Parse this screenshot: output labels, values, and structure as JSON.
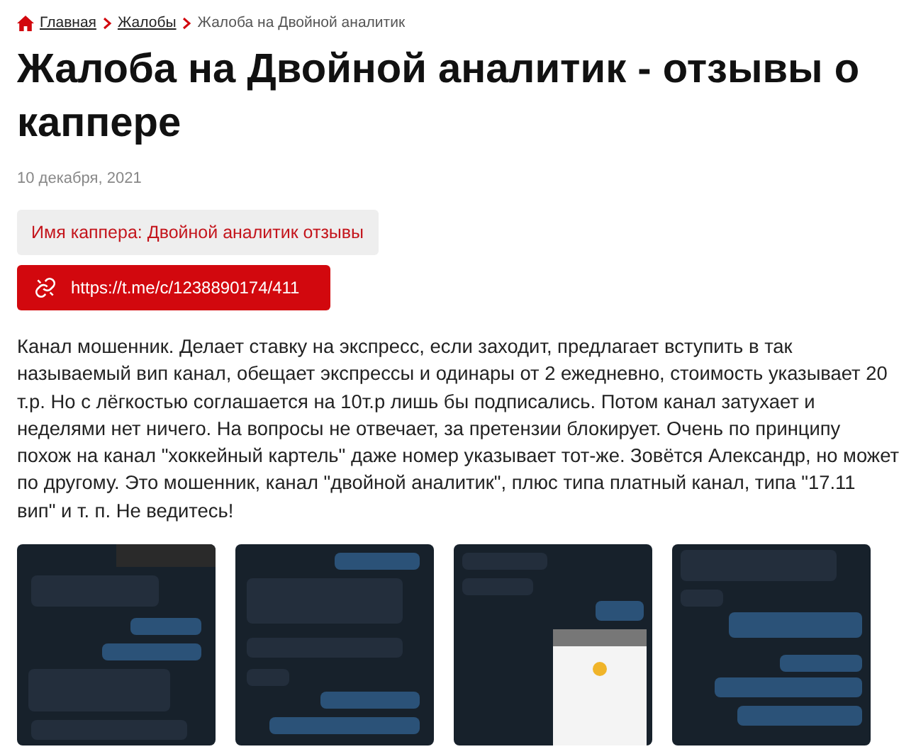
{
  "breadcrumbs": [
    {
      "label": "Главная",
      "link": true
    },
    {
      "label": "Жалобы",
      "link": true
    },
    {
      "label": "Жалоба на Двойной аналитик",
      "link": false
    }
  ],
  "title": "Жалоба на Двойной аналитик - отзывы о каппере",
  "date": "10 декабря, 2021",
  "capper_name": "Имя каппера: Двойной аналитик отзывы",
  "link_button": "https://t.me/c/1238890174/411",
  "body": "Канал мошенник. Делает ставку на экспресс, если заходит, предлагает вступить в так называемый вип канал, обещает экспрессы и одинары от 2 ежедневно, стоимость указывает 20 т.р. Но с лёгкостью соглашается на 10т.р лишь бы подписались. Потом канал затухает и неделями нет ничего. На вопросы не отвечает, за претензии блокирует. Очень по принципу похож на канал \"хоккейный картель\" даже номер указывает тот-же. Зовётся Александр, но может по другому. Это мошенник, канал \"двойной аналитик\", плюс типа платный канал, типа \"17.11 вип\" и т. п. Не ведитесь!"
}
